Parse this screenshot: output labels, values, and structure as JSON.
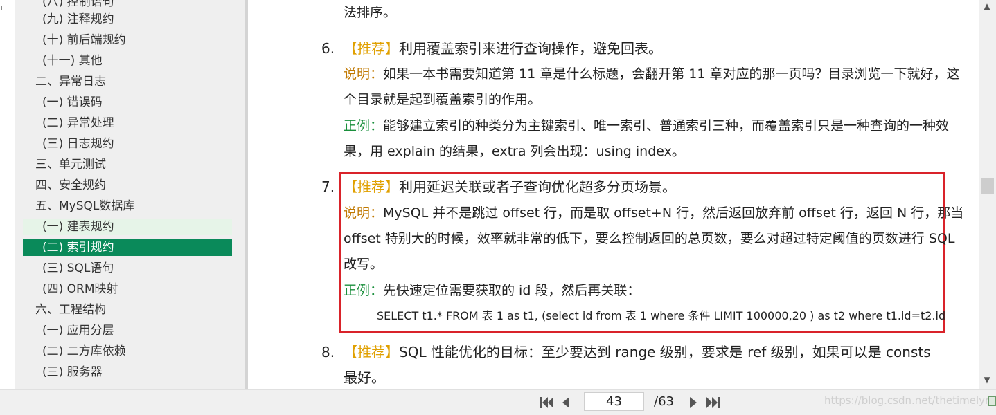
{
  "outline": {
    "items": [
      {
        "label": "(八) 控制语句"
      },
      {
        "label": "(九) 注释规约"
      },
      {
        "label": "(十) 前后端规约"
      },
      {
        "label": "(十一) 其他"
      },
      {
        "label": "二、异常日志"
      },
      {
        "label": "(一) 错误码"
      },
      {
        "label": "(二) 异常处理"
      },
      {
        "label": "(三) 日志规约"
      },
      {
        "label": "三、单元测试"
      },
      {
        "label": "四、安全规约"
      },
      {
        "label": "五、MySQL数据库"
      },
      {
        "label": "(一) 建表规约"
      },
      {
        "label": "(二) 索引规约"
      },
      {
        "label": "(三) SQL语句"
      },
      {
        "label": "(四) ORM映射"
      },
      {
        "label": "六、工程结构"
      },
      {
        "label": "(一) 应用分层"
      },
      {
        "label": "(二) 二方库依赖"
      },
      {
        "label": "(三) 服务器"
      }
    ]
  },
  "document": {
    "prev_tail": "法排序。",
    "item6": {
      "number": "6.",
      "tag": "【推荐】",
      "title": "利用覆盖索引来进行查询操作，避免回表。",
      "note_label": "说明：",
      "note_line1": "如果一本书需要知道第 11 章是什么标题，会翻开第 11 章对应的那一页吗？目录浏览一下就好，这",
      "note_line2": "个目录就是起到覆盖索引的作用。",
      "example_label": "正例：",
      "example_line1": "能够建立索引的种类分为主键索引、唯一索引、普通索引三种，而覆盖索引只是一种查询的一种效",
      "example_line2": "果，用 explain 的结果，extra 列会出现：using index。"
    },
    "item7": {
      "number": "7.",
      "tag": "【推荐】",
      "title": "利用延迟关联或者子查询优化超多分页场景。",
      "note_label": "说明：",
      "note_line1": "MySQL 并不是跳过 offset 行，而是取 offset+N 行，然后返回放弃前 offset 行，返回 N 行，那当",
      "note_line2": "offset 特别大的时候，效率就非常的低下，要么控制返回的总页数，要么对超过特定阈值的页数进行 SQL",
      "note_line3": "改写。",
      "example_label": "正例：",
      "example_line1": "先快速定位需要获取的 id 段，然后再关联：",
      "code": "SELECT t1.* FROM  表 1 as t1, (select id from  表 1 where  条件  LIMIT 100000,20 ) as t2 where t1.id=t2.id"
    },
    "item8": {
      "number": "8.",
      "tag": "【推荐】",
      "title_line1": "SQL 性能优化的目标：至少要达到  range  级别，要求是 ref 级别，如果可以是 consts",
      "title_line2": "最好。"
    }
  },
  "pager": {
    "current_page": "43",
    "total": "/63"
  },
  "watermark": "https://blog.csdn.net/thetimelyrain",
  "colors": {
    "tag": "#e0a000",
    "note_label": "#c07800",
    "example_label": "#1a8f3c",
    "active_outline": "#0a8a5a",
    "highlight_border": "#d9232a"
  }
}
